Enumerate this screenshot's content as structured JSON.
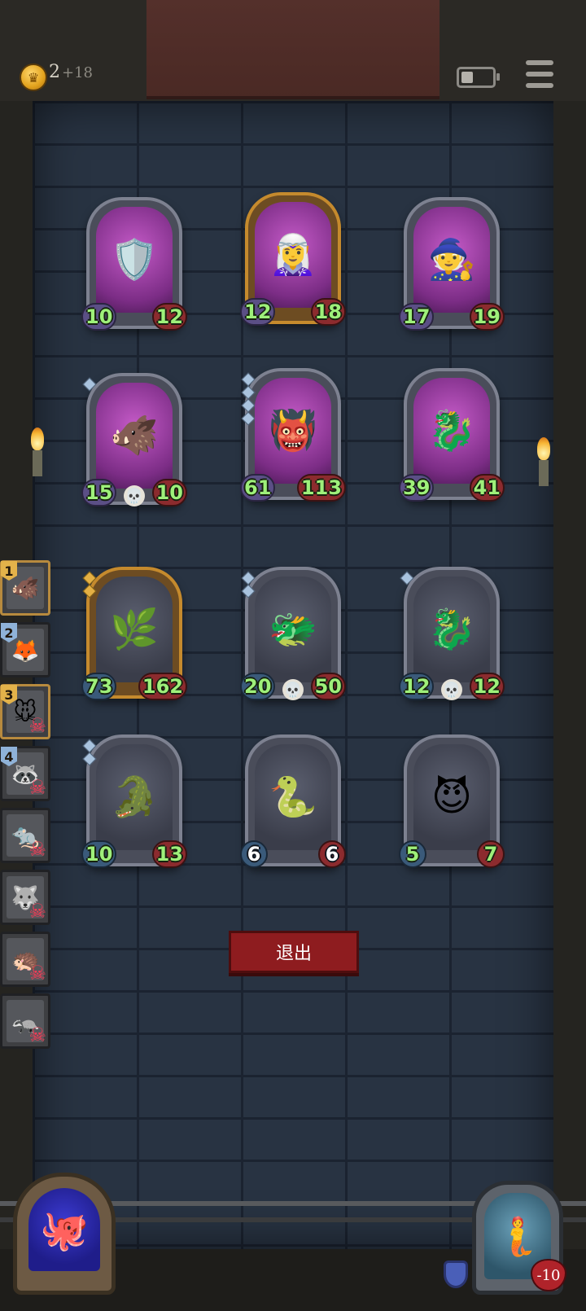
{
  "hud": {
    "gold": "2",
    "gold_delta": "+18"
  },
  "board": {
    "cards": [
      {
        "creature": "🛡️",
        "attack": "10",
        "health": "12",
        "style": "purple"
      },
      {
        "creature": "🧝‍♀️",
        "attack": "12",
        "health": "18",
        "style": "purple golden"
      },
      {
        "creature": "🧙",
        "attack": "17",
        "health": "19",
        "style": "purple"
      },
      {
        "creature": "🐗",
        "attack": "15",
        "health": "10",
        "style": "purple"
      },
      {
        "creature": "👹",
        "attack": "61",
        "health": "113",
        "style": "purple"
      },
      {
        "creature": "🐉",
        "attack": "39",
        "health": "41",
        "style": "purple"
      },
      {
        "creature": "🌿",
        "attack": "73",
        "health": "162",
        "style": "golden"
      },
      {
        "creature": "🐲",
        "attack": "20",
        "health": "50",
        "style": "plain"
      },
      {
        "creature": "🐉",
        "attack": "12",
        "health": "12",
        "style": "plain"
      },
      {
        "creature": "🐊",
        "attack": "10",
        "health": "13",
        "style": "plain"
      },
      {
        "creature": "🐍",
        "attack": "6",
        "health": "6",
        "style": "plain"
      },
      {
        "creature": "😈",
        "attack": "5",
        "health": "7",
        "style": "plain"
      }
    ]
  },
  "roster": [
    {
      "rank": "1",
      "creature": "🐗"
    },
    {
      "rank": "2",
      "creature": "🦊"
    },
    {
      "rank": "3",
      "creature": "🐭"
    },
    {
      "rank": "4",
      "creature": "🦝"
    },
    {
      "rank": "",
      "creature": "🐀"
    },
    {
      "rank": "",
      "creature": "🐺"
    },
    {
      "rank": "",
      "creature": "🦔"
    },
    {
      "rank": "",
      "creature": "🦡"
    }
  ],
  "exit_button_label": "退出",
  "player": {
    "hp": "-10"
  },
  "icons": {
    "skull": "💀",
    "dead": "☠",
    "left_portrait": "🐙",
    "right_portrait": "🧜"
  }
}
